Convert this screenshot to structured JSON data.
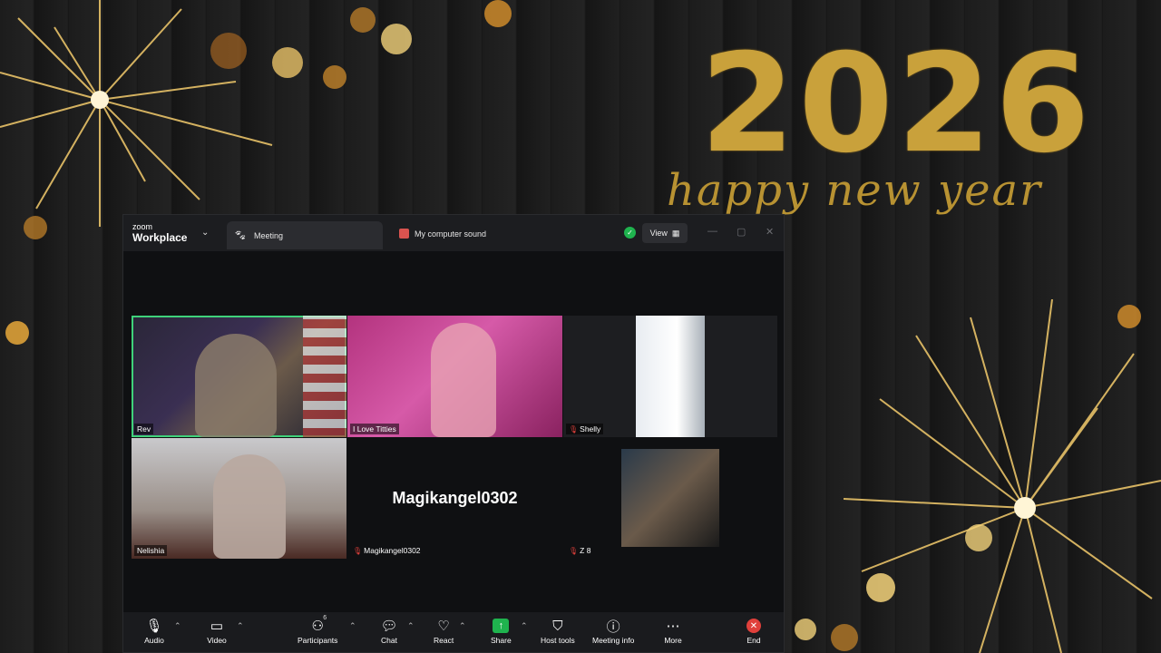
{
  "background": {
    "year": "2026",
    "greeting": "happy new year",
    "gold": "#c9a13b"
  },
  "window": {
    "brand_top": "zoom",
    "brand_bottom": "Workplace",
    "tab_meeting": "Meeting",
    "tab_sound": "My computer sound",
    "view_label": "View"
  },
  "participants": [
    {
      "name": "Rev",
      "muted": false,
      "active": true
    },
    {
      "name": "I Love Titties",
      "muted": false
    },
    {
      "name": "Shelly",
      "muted": true
    },
    {
      "name": "Nelishia",
      "muted": false
    },
    {
      "name": "Magikangel0302",
      "muted": true,
      "display_name": "Magikangel0302"
    },
    {
      "name": "Z 8",
      "muted": true
    }
  ],
  "toolbar": {
    "audio": "Audio",
    "video": "Video",
    "participants": "Participants",
    "participants_count": "6",
    "chat": "Chat",
    "react": "React",
    "share": "Share",
    "host_tools": "Host tools",
    "meeting_info": "Meeting info",
    "more": "More",
    "end": "End"
  },
  "icons": {
    "shield": "verified-shield-icon",
    "grid": "grid-icon",
    "paw": "paw-icon",
    "mic": "microphone-icon",
    "camera": "camera-icon",
    "users": "participants-icon",
    "chat": "chat-bubble-icon",
    "heart": "heart-icon",
    "share": "share-arrow-icon",
    "host": "host-shield-icon",
    "info": "info-icon",
    "more": "ellipsis-icon",
    "end": "close-icon"
  },
  "colors": {
    "accent_green": "#1fb34e",
    "speaker_outline": "#3fd27a",
    "end_red": "#e0403b"
  }
}
